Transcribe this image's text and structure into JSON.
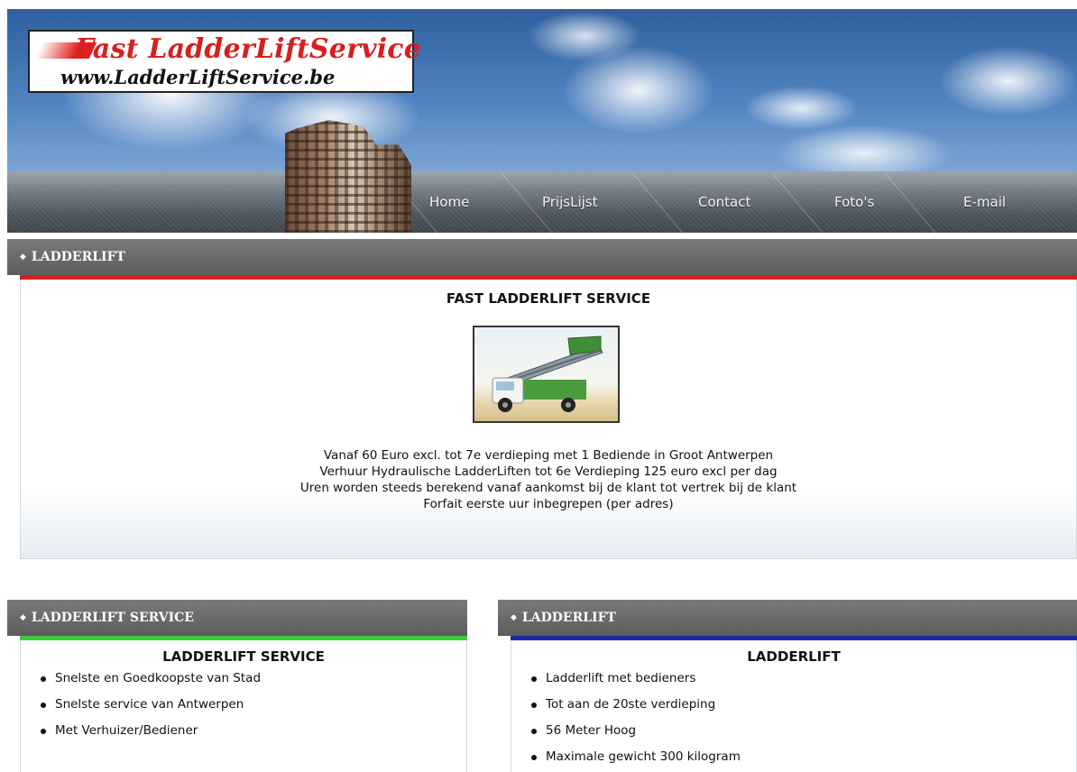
{
  "header": {
    "logo_title": "Fast LadderLiftService",
    "logo_url": "www.LadderLiftService.be",
    "nav": [
      "Home",
      "PrijsLijst",
      "Contact",
      "Foto's",
      "E-mail"
    ]
  },
  "main_panel": {
    "heading": "LADDERLIFT",
    "title": "FAST LADDERLIFT SERVICE",
    "image_alt": "ladderlift-truck",
    "lines": [
      "Vanaf 60 Euro excl. tot 7e verdieping met 1 Bediende in Groot Antwerpen",
      "Verhuur Hydraulische LadderLiften tot 6e Verdieping 125 euro excl per dag",
      "Uren worden steeds berekend vanaf aankomst bij de klant tot vertrek bij de klant",
      "Forfait eerste uur inbegrepen (per adres)"
    ],
    "accent": "#d42020"
  },
  "left_panel": {
    "heading": "LADDERLIFT SERVICE",
    "title": "LADDERLIFT SERVICE",
    "items": [
      "Snelste en Goedkoopste van Stad",
      "Snelste service van Antwerpen",
      "Met Verhuizer/Bediener"
    ],
    "accent": "#3ccc3c"
  },
  "right_panel": {
    "heading": "LADDERLIFT",
    "title": "LADDERLIFT",
    "items": [
      "Ladderlift met bedieners",
      "Tot aan de 20ste verdieping",
      "56 Meter Hoog",
      "Maximale gewicht 300 kilogram"
    ],
    "accent": "#1a2ea8"
  }
}
